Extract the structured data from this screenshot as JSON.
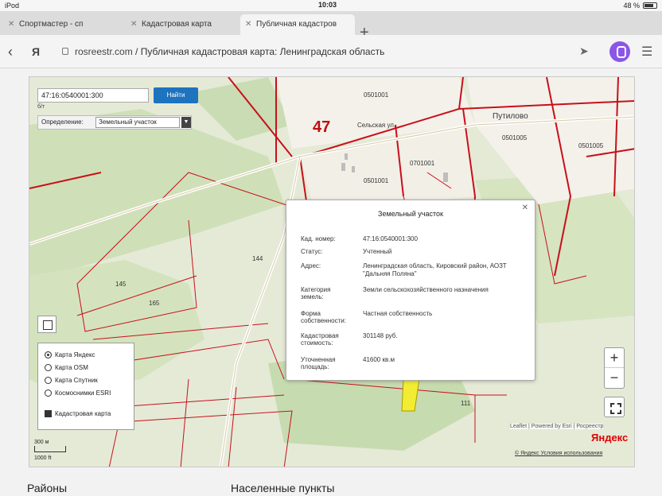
{
  "status_bar": {
    "device": "iPod",
    "time": "10:03",
    "battery": "48 %"
  },
  "tabs": [
    {
      "label": "Спортмастер - сп"
    },
    {
      "label": "Кадастровая карта"
    },
    {
      "label": "Публичная кадастров"
    }
  ],
  "address": {
    "domain": "rosreestr.com",
    "separator": "/",
    "page_title": "Публичная кадастровая карта: Ленинградская область"
  },
  "map": {
    "search": {
      "value": "47:16:0540001:300",
      "button_label": "Найти",
      "subtext": "б/т"
    },
    "filter": {
      "label": "Определение:",
      "selected": "Земельный участок"
    },
    "labels": {
      "district": "47",
      "parcel_a": "0501001",
      "parcel_b": "0501001",
      "parcel_c": "0701001",
      "parcel_d": "0501005",
      "parcel_e": "0501005",
      "village": "Путилово",
      "n1": "144",
      "n2": "145",
      "n3": "165",
      "n4": "111",
      "road": "Сельская ул."
    },
    "layers": {
      "items": [
        {
          "label": "Карта Яндекс",
          "selected": true
        },
        {
          "label": "Карта OSM",
          "selected": false
        },
        {
          "label": "Карта Спутник",
          "selected": false
        },
        {
          "label": "Космоснимки ESRI",
          "selected": false
        }
      ],
      "overlay": "Кадастровая карта"
    },
    "scale": {
      "top": "300 м",
      "bottom": "1000 ft"
    },
    "attribution": "Leaflet | Powered by Esri | Росреестр",
    "yandex_logo": "Яндекс",
    "terms": "© Яндекс Условия использования"
  },
  "popup": {
    "title": "Земельный участок",
    "rows": [
      {
        "label": "Кад. номер:",
        "value": "47:16:0540001:300"
      },
      {
        "label": "Статус:",
        "value": "Учтенный"
      },
      {
        "label": "Адрес:",
        "value": "Ленинградская область, Кировский район, АОЗТ \"Дальняя Поляна\""
      },
      {
        "label": "Категория земель:",
        "value": "Земли сельскохозяйственного назначения"
      },
      {
        "label": "Форма собственности:",
        "value": "Частная собственность"
      },
      {
        "label": "Кадастровая стоимость:",
        "value": "301148 руб."
      },
      {
        "label": "Уточненная площадь:",
        "value": "41600 кв.м"
      }
    ]
  },
  "bottom": {
    "left": "Районы",
    "right": "Населенные пункты"
  }
}
